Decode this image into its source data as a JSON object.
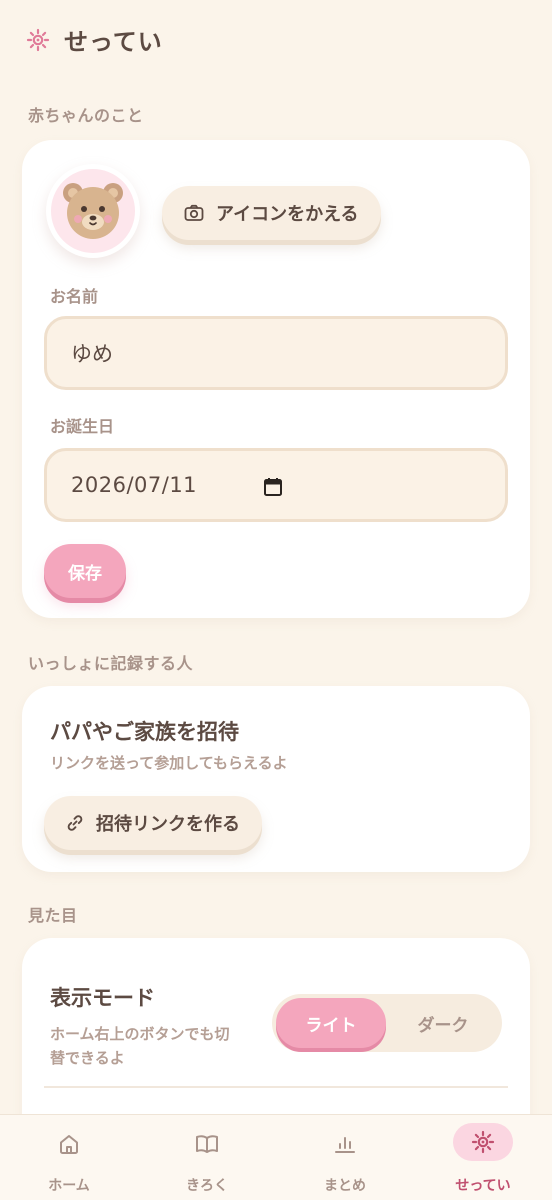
{
  "header": {
    "title": "せってい",
    "icon": "gear-icon"
  },
  "sections": {
    "baby": "赤ちゃんのこと",
    "family": "いっしょに記録する人",
    "appearance": "見た目"
  },
  "baby_card": {
    "change_icon_label": "アイコンをかえる",
    "name_label": "お名前",
    "name_value": "ゆめ",
    "birthday_label": "お誕生日",
    "birthday_value": "2026/07/11",
    "save_label": "保存"
  },
  "family_card": {
    "title": "パパやご家族を招待",
    "subtitle": "リンクを送って参加してもらえるよ",
    "invite_label": "招待リンクを作る"
  },
  "appearance_card": {
    "mode_title": "表示モード",
    "mode_desc_line1": "ホーム右上のボタンでも切",
    "mode_desc_line2": "替できるよ",
    "option_light": "ライト",
    "option_dark": "ダーク",
    "selected": "ライト"
  },
  "nav": {
    "items": [
      {
        "label": "ホーム",
        "icon": "home-icon"
      },
      {
        "label": "きろく",
        "icon": "book-icon"
      },
      {
        "label": "まとめ",
        "icon": "chart-icon"
      },
      {
        "label": "せってい",
        "icon": "gear-icon"
      }
    ],
    "active": "せってい"
  },
  "colors": {
    "background": "#fbf4ea",
    "accent_pink": "#f4a6bd",
    "text_dark": "#5c4a42",
    "text_muted": "#a8938a",
    "nav_active": "#c0506f"
  }
}
